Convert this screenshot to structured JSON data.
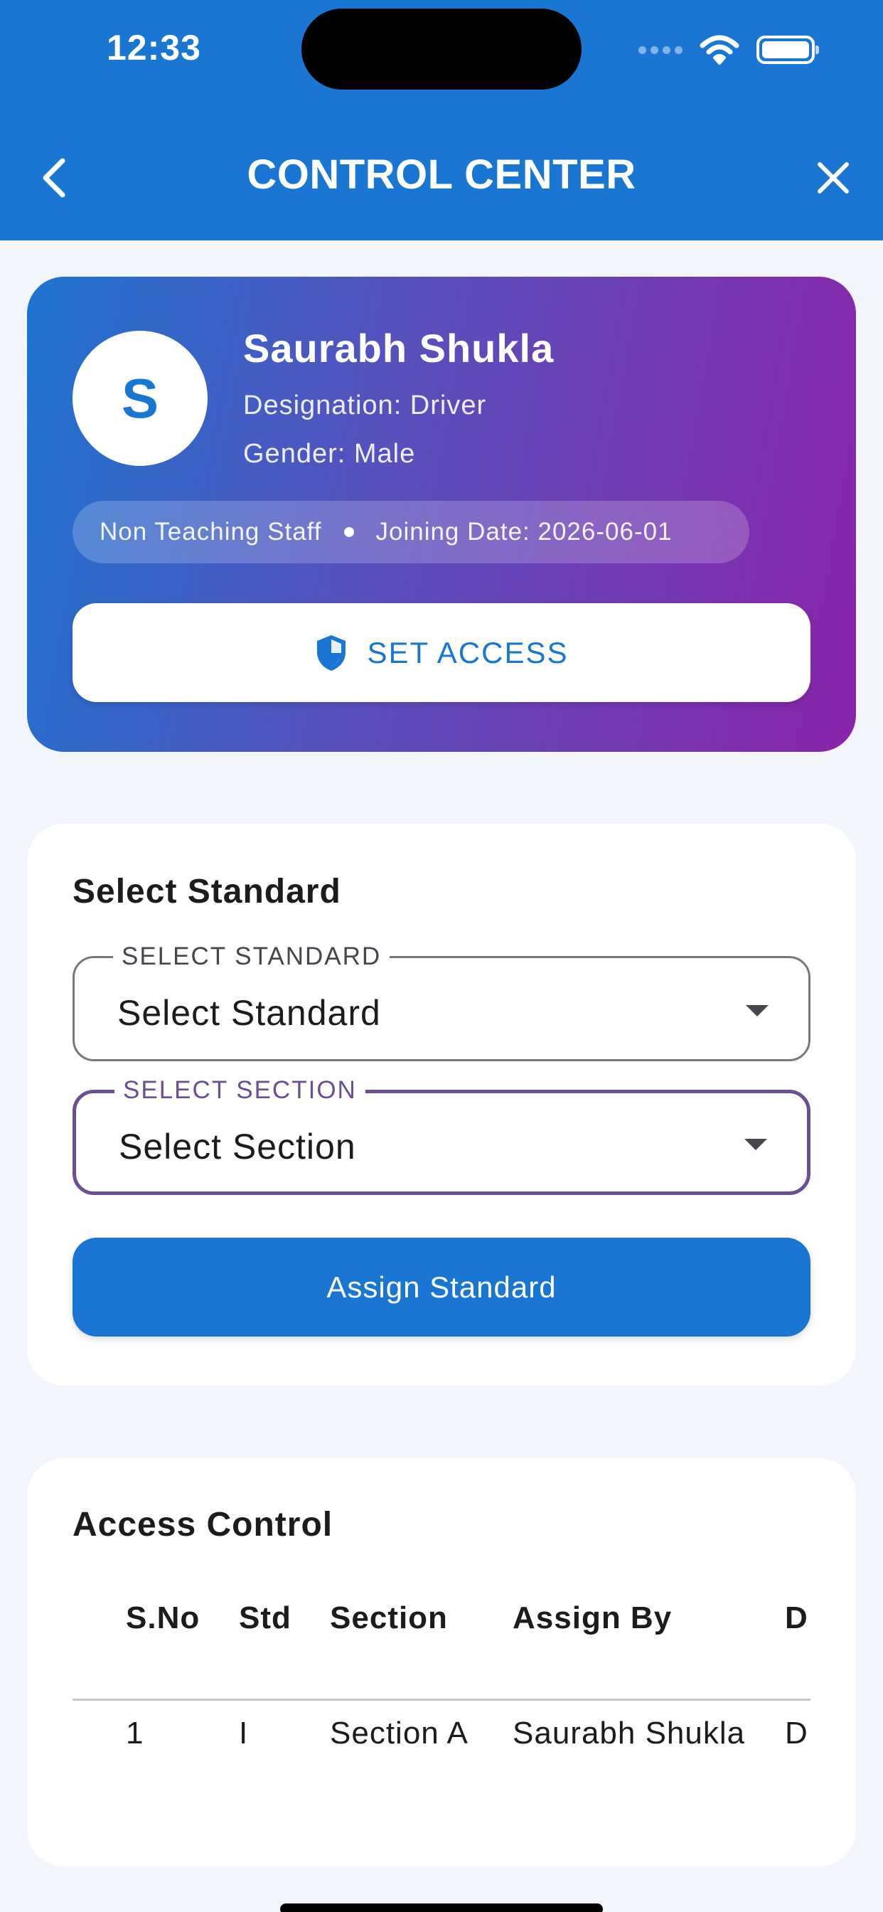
{
  "status_bar": {
    "time": "12:33"
  },
  "header": {
    "title": "CONTROL CENTER",
    "back_icon": "chevron-left-icon",
    "close_icon": "close-icon"
  },
  "profile": {
    "avatar_initial": "S",
    "name": "Saurabh Shukla",
    "designation": "Designation: Driver",
    "gender": "Gender: Male",
    "staff_type": "Non Teaching Staff",
    "joining_date": "Joining Date: 2026-06-01",
    "set_access_label": "SET ACCESS",
    "set_access_icon": "shield-icon"
  },
  "standard_card": {
    "heading": "Select Standard",
    "standard_field": {
      "label": "SELECT STANDARD",
      "value": "Select Standard"
    },
    "section_field": {
      "label": "SELECT SECTION",
      "value": "Select Section"
    },
    "assign_button": "Assign Standard"
  },
  "access_control": {
    "heading": "Access Control",
    "columns": [
      "S.No",
      "Std",
      "Section",
      "Assign By",
      "D"
    ],
    "rows": [
      [
        "1",
        "I",
        "Section A",
        "Saurabh Shukla",
        "D"
      ]
    ]
  },
  "colors": {
    "primary": "#1976d2",
    "gradient_start": "#1e74d0",
    "gradient_end": "#8a24aa",
    "focus_outline": "#6b4f93",
    "background": "#f2f5fc"
  }
}
